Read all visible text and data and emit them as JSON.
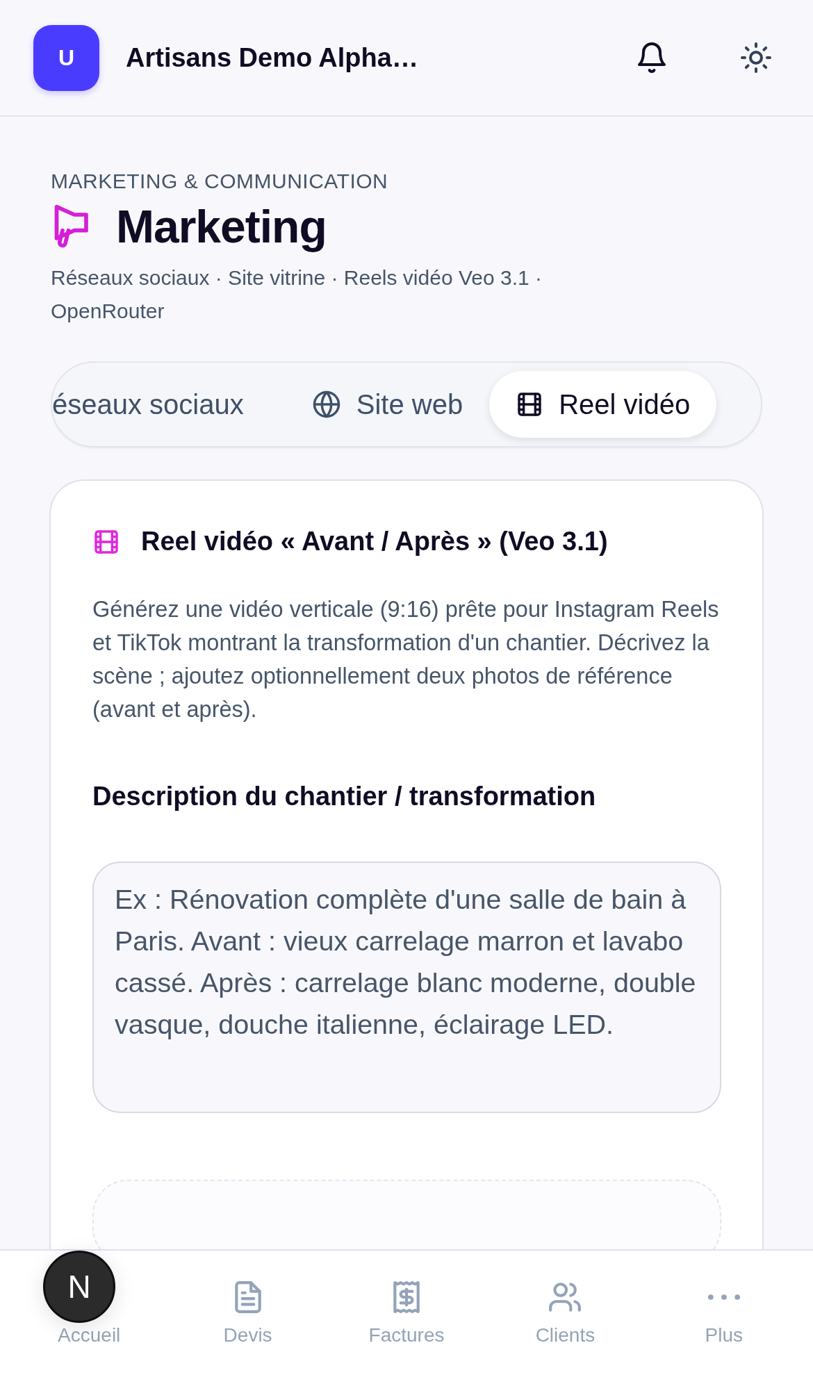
{
  "header": {
    "avatar": "U",
    "title": "Artisans Demo Alpha…"
  },
  "intro": {
    "eyebrow": "MARKETING & COMMUNICATION",
    "title": "Marketing",
    "subtitle": "Réseaux sociaux · Site vitrine · Reels vidéo Veo 3.1 · OpenRouter"
  },
  "tabs": [
    {
      "label": "éseaux sociaux",
      "selected": false
    },
    {
      "label": "Site web",
      "selected": false
    },
    {
      "label": "Reel vidéo",
      "selected": true
    }
  ],
  "card": {
    "title": "Reel vidéo « Avant / Après » (Veo 3.1)",
    "description": "Générez une vidéo verticale (9:16) prête pour Instagram Reels et TikTok montrant la transformation d'un chantier. Décrivez la scène ; ajoutez optionnellement deux photos de référence (avant et après).",
    "field_label": "Description du chantier / transformation",
    "placeholder": "Ex : Rénovation complète d'une salle de bain à Paris. Avant : vieux carrelage marron et lavabo cassé. Après : carrelage blanc moderne, double vasque, douche italienne, éclairage LED."
  },
  "bottom_nav": [
    {
      "label": "Accueil",
      "selected": false
    },
    {
      "label": "Devis",
      "selected": false
    },
    {
      "label": "Factures",
      "selected": false
    },
    {
      "label": "Clients",
      "selected": false
    },
    {
      "label": "Plus",
      "selected": false
    }
  ],
  "dev_badge": {
    "label": "N"
  }
}
